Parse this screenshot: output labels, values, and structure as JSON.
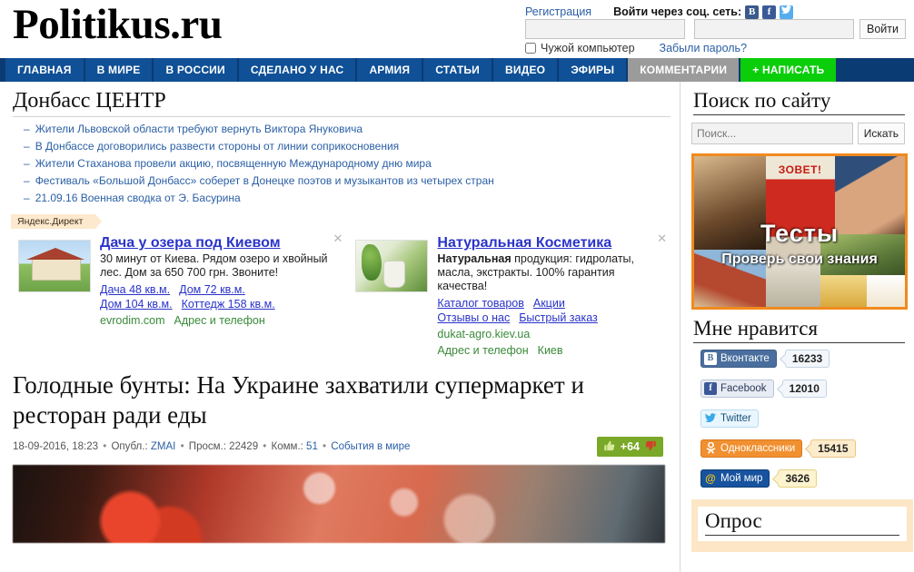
{
  "site": {
    "logo": "Politikus.ru"
  },
  "header": {
    "register_label": "Регистрация",
    "social_login_label": "Войти через соц. сеть:",
    "social_icons": [
      {
        "name": "vk-icon",
        "glyph": "В"
      },
      {
        "name": "facebook-icon",
        "glyph": "f"
      },
      {
        "name": "twitter-icon",
        "glyph": "🐦"
      }
    ],
    "username_value": "",
    "username_placeholder": "",
    "password_value": "",
    "password_placeholder": "",
    "login_button": "Войти",
    "foreign_computer_label": "Чужой компьютер",
    "forgot_password_label": "Забыли пароль?"
  },
  "nav": {
    "items": [
      {
        "label": "ГЛАВНАЯ",
        "style": "blue"
      },
      {
        "label": "В МИРЕ",
        "style": "blue"
      },
      {
        "label": "В РОССИИ",
        "style": "blue"
      },
      {
        "label": "СДЕЛАНО У НАС",
        "style": "blue"
      },
      {
        "label": "АРМИЯ",
        "style": "blue"
      },
      {
        "label": "СТАТЬИ",
        "style": "blue"
      },
      {
        "label": "ВИДЕО",
        "style": "blue"
      },
      {
        "label": "ЭФИРЫ",
        "style": "blue"
      },
      {
        "label": "КОММЕНТАРИИ",
        "style": "gray"
      },
      {
        "label": "+ НАПИСАТЬ",
        "style": "green"
      }
    ],
    "colors": {
      "bar": "#0b3b73",
      "item": "#0f5096",
      "gray": "#9b9b9b",
      "green": "#0ace0a"
    }
  },
  "donbass": {
    "title": "Донбасс ЦЕНТР",
    "items": [
      "Жители Львовской области требуют вернуть Виктора Януковича",
      "В Донбассе договорились развести стороны от линии соприкосновения",
      "Жители Стаханова провели акцию, посвященную Международному дню мира",
      "Фестиваль «Большой Донбасс» соберет в Донецке поэтов и музыкантов из четырех стран",
      "21.09.16 Военная сводка от Э. Басурина"
    ]
  },
  "ads": {
    "label": "Яндекс.Директ",
    "close_glyph": "✕",
    "blocks": [
      {
        "title": "Дача у озера под Киевом",
        "text": "30 минут от Киева. Рядом озеро и хвойный лес. Дом за 650 700 грн. Звоните!",
        "sublinks": [
          "Дача 48 кв.м.",
          "Дом 72 кв.м.",
          "Дом 104 кв.м.",
          "Коттедж 158 кв.м."
        ],
        "domain": "evrodim.com",
        "contact": "Адрес и телефон",
        "city": ""
      },
      {
        "title": "Натуральная Косметика",
        "text_bold": "Натуральная",
        "text": " продукция: гидролаты, масла, экстракты. 100% гарантия качества!",
        "sublinks": [
          "Каталог товаров",
          "Акции",
          "Отзывы о нас",
          "Быстрый заказ"
        ],
        "domain": "dukat-agro.kiev.ua",
        "contact": "Адрес и телефон",
        "city": "Киев"
      }
    ]
  },
  "article": {
    "title": "Голодные бунты: На Украине захватили супермаркет и ресторан ради еды",
    "date": "18-09-2016, 18:23",
    "author_label": "Опубл.:",
    "author": "ZMAI",
    "views_label": "Просм.:",
    "views": "22429",
    "comments_label": "Комм.:",
    "comments": "51",
    "category": "События в мире",
    "rating_value": "+64",
    "thumb_up_glyph": "👍",
    "thumb_down_glyph": "👎",
    "rating_color": "#7aa828"
  },
  "sidebar": {
    "search": {
      "title": "Поиск по сайту",
      "input_value": "",
      "input_placeholder": "Поиск...",
      "button_label": "Искать"
    },
    "banner": {
      "zovet": "ЗОВЕТ!",
      "title": "Тесты",
      "subtitle": "Проверь свои знания",
      "border_color": "#f08a1e"
    },
    "likes": {
      "title": "Мне нравится",
      "items": [
        {
          "network": "Вконтакте",
          "icon": "vk-icon",
          "glyph": "В",
          "count": "16233",
          "btn_class": "lb-vk",
          "cnt_class": "cnt-blue"
        },
        {
          "network": "Facebook",
          "icon": "facebook-icon",
          "glyph": "f",
          "count": "12010",
          "btn_class": "lb-fb",
          "cnt_class": "cnt-blue"
        },
        {
          "network": "Twitter",
          "icon": "twitter-icon",
          "glyph": "🐦",
          "count": "",
          "btn_class": "lb-tw",
          "cnt_class": "cnt-blue"
        },
        {
          "network": "Одноклассники",
          "icon": "odnoklassniki-icon",
          "glyph": "ok",
          "count": "15415",
          "btn_class": "lb-ok",
          "cnt_class": "cnt-orange"
        },
        {
          "network": "Мой мир",
          "icon": "moimir-icon",
          "glyph": "@",
          "count": "3626",
          "btn_class": "lb-mm",
          "cnt_class": "cnt-yellow"
        }
      ]
    },
    "poll": {
      "title": "Опрос"
    }
  }
}
